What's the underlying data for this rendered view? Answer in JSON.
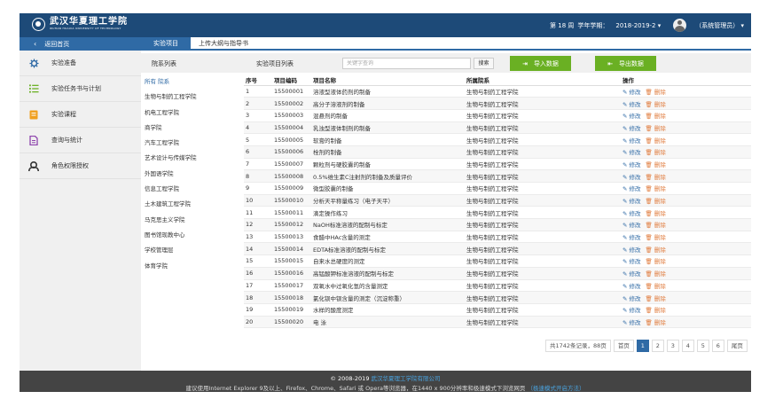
{
  "header": {
    "logo_cn": "武汉华夏理工学院",
    "logo_en": "WUHAN HUAXIA UNIVERSITY OF TECHNOLOGY",
    "week": "第 18 周",
    "term_label": "学年学期：",
    "term": "2018-2019-2 ▾",
    "user": "（系统管理员） ▾"
  },
  "sidebar": {
    "back": "返回首页",
    "items": [
      {
        "label": "实验准备",
        "icon": "gear-icon",
        "color": "#2f6aa5"
      },
      {
        "label": "实验任务书与计划",
        "icon": "list-icon",
        "color": "#6ab023"
      },
      {
        "label": "实验课程",
        "icon": "book-icon",
        "color": "#f0a020"
      },
      {
        "label": "查询与统计",
        "icon": "document-icon",
        "color": "#8e44ad"
      },
      {
        "label": "角色权限授权",
        "icon": "user-icon",
        "color": "#333333"
      }
    ]
  },
  "tabs": [
    "实验项目",
    "上传大纲与指导书"
  ],
  "toolbar": {
    "dept_list_label": "院系列表",
    "project_list_label": "实验项目列表",
    "search_placeholder": "关键字查询",
    "search_button": "搜索",
    "import_button": "导入数据",
    "export_button": "导出数据"
  },
  "departments": [
    "所有 院系",
    "生物与制药工程学院",
    "机电工程学院",
    "商学院",
    "汽车工程学院",
    "艺术设计与传媒学院",
    "外国语学院",
    "信息工程学院",
    "土木建筑工程学院",
    "马克思主义学院",
    "图书馆现教中心",
    "学校管理层",
    "体育学院"
  ],
  "table": {
    "headers": [
      "序号",
      "项目编码",
      "项目名称",
      "所属院系",
      "操作"
    ],
    "edit_label": "✎ 修改",
    "delete_label": "🗑 删除",
    "rows": [
      [
        "1",
        "15500001",
        "溶液型液体药剂的制备",
        "生物与制药工程学院"
      ],
      [
        "2",
        "15500002",
        "高分子溶液剂的制备",
        "生物与制药工程学院"
      ],
      [
        "3",
        "15500003",
        "混悬剂的制备",
        "生物与制药工程学院"
      ],
      [
        "4",
        "15500004",
        "乳浊型液体制剂的制备",
        "生物与制药工程学院"
      ],
      [
        "5",
        "15500005",
        "软膏的制备",
        "生物与制药工程学院"
      ],
      [
        "6",
        "15500006",
        "栓剂的制备",
        "生物与制药工程学院"
      ],
      [
        "7",
        "15500007",
        "颗粒剂与硬胶囊的制备",
        "生物与制药工程学院"
      ],
      [
        "8",
        "15500008",
        "0.5%维生素C注射剂的制备及质量评价",
        "生物与制药工程学院"
      ],
      [
        "9",
        "15500009",
        "微型胶囊的制备",
        "生物与制药工程学院"
      ],
      [
        "10",
        "15500010",
        "分析天平称量练习（电子天平）",
        "生物与制药工程学院"
      ],
      [
        "11",
        "15500011",
        "滴定操作练习",
        "生物与制药工程学院"
      ],
      [
        "12",
        "15500012",
        "NaOH标准溶液的配制与标定",
        "生物与制药工程学院"
      ],
      [
        "13",
        "15500013",
        "食醋中HAc含量的测定",
        "生物与制药工程学院"
      ],
      [
        "14",
        "15500014",
        "EDTA标准溶液的配制与标定",
        "生物与制药工程学院"
      ],
      [
        "15",
        "15500015",
        "自来水总硬度的测定",
        "生物与制药工程学院"
      ],
      [
        "16",
        "15500016",
        "高锰酸钾标准溶液的配制与标定",
        "生物与制药工程学院"
      ],
      [
        "17",
        "15500017",
        "双氧水中过氧化氢的含量测定",
        "生物与制药工程学院"
      ],
      [
        "18",
        "15500018",
        "氯化钡中钡含量的测定（沉淀称重）",
        "生物与制药工程学院"
      ],
      [
        "19",
        "15500019",
        "水样的酸度测定",
        "生物与制药工程学院"
      ],
      [
        "20",
        "15500020",
        "电 泳",
        "生物与制药工程学院"
      ]
    ]
  },
  "pagination": {
    "summary": "共1742条记录，88页",
    "first": "首页",
    "pages": [
      "1",
      "2",
      "3",
      "4",
      "5",
      "6"
    ],
    "current": "1",
    "last": "尾页"
  },
  "footer": {
    "copyright": "© 2008-2019",
    "org": "武汉华夏理工学院有限公司",
    "notice": "建议使用Internet Explorer 9及以上、Firefox、Chrome、Safari 或 Opera等浏览器，在1440 x 900分辨率和极速模式下浏览网页",
    "link": "（极速模式开启方法）"
  }
}
